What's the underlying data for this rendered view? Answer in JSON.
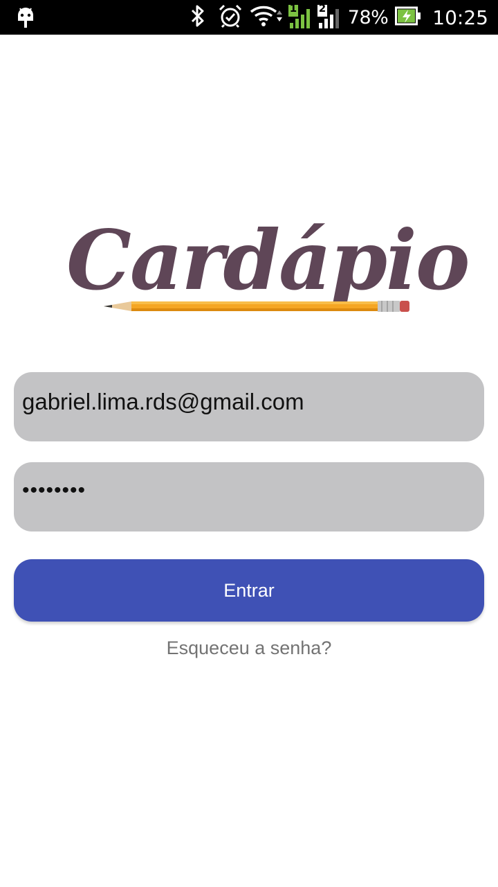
{
  "status_bar": {
    "battery_percent": "78%",
    "time": "10:25",
    "sim1_label": "1",
    "sim2_label": "2",
    "icons": [
      "android-debug-icon",
      "bluetooth-icon",
      "alarm-icon",
      "wifi-icon",
      "signal-sim1-icon",
      "signal-sim2-icon",
      "battery-charging-icon"
    ],
    "colors": {
      "sim1_signal": "#7cc242",
      "battery_fill": "#7cc242"
    }
  },
  "logo": {
    "text": "Cardápio",
    "color": "#5f4657",
    "decoration": "pencil"
  },
  "login_form": {
    "email_value": "gabriel.lima.rds@gmail.com",
    "password_value": "••••••••",
    "submit_label": "Entrar",
    "forgot_password_label": "Esqueceu a senha?"
  },
  "colors": {
    "background": "#ffffff",
    "input_background": "#c3c3c5",
    "primary_button": "#3f51b5",
    "link_text": "#737373"
  }
}
